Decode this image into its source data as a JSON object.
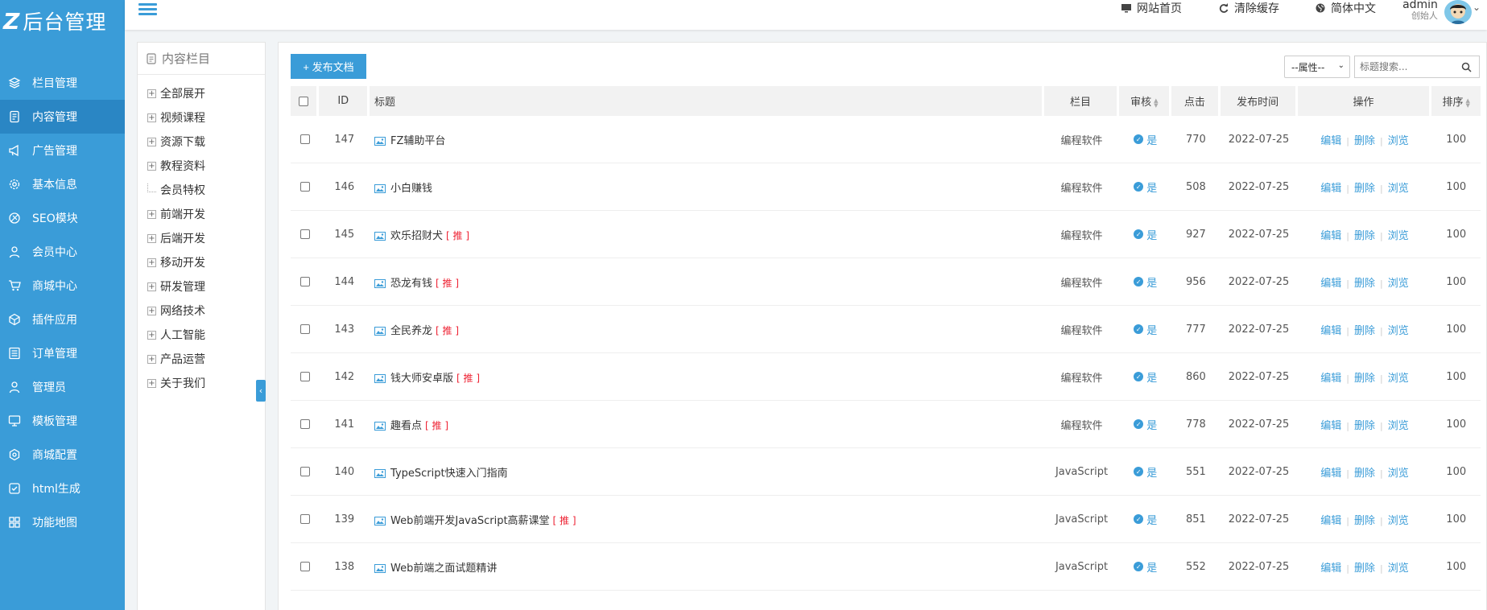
{
  "brand": {
    "logo_mark": "Z",
    "title": "后台管理"
  },
  "sidebar": {
    "items": [
      {
        "label": "栏目管理",
        "icon": "layers-icon",
        "active": false
      },
      {
        "label": "内容管理",
        "icon": "document-icon",
        "active": true
      },
      {
        "label": "广告管理",
        "icon": "megaphone-icon",
        "active": false
      },
      {
        "label": "基本信息",
        "icon": "gear-icon",
        "active": false
      },
      {
        "label": "SEO模块",
        "icon": "seo-icon",
        "active": false
      },
      {
        "label": "会员中心",
        "icon": "user-icon",
        "active": false
      },
      {
        "label": "商城中心",
        "icon": "cart-icon",
        "active": false
      },
      {
        "label": "插件应用",
        "icon": "cube-icon",
        "active": false
      },
      {
        "label": "订单管理",
        "icon": "list-icon",
        "active": false
      },
      {
        "label": "管理员",
        "icon": "admin-user-icon",
        "active": false
      },
      {
        "label": "模板管理",
        "icon": "monitor-icon",
        "active": false
      },
      {
        "label": "商城配置",
        "icon": "settings-hex-icon",
        "active": false
      },
      {
        "label": "html生成",
        "icon": "checkbox-icon",
        "active": false
      },
      {
        "label": "功能地图",
        "icon": "grid-icon",
        "active": false
      }
    ]
  },
  "header": {
    "site_home": "网站首页",
    "clear_cache": "清除缓存",
    "language": "简体中文",
    "username": "admin",
    "role": "创始人"
  },
  "categories": {
    "title": "内容栏目",
    "items": [
      {
        "label": "全部展开",
        "expandable": true
      },
      {
        "label": "视频课程",
        "expandable": true
      },
      {
        "label": "资源下载",
        "expandable": true
      },
      {
        "label": "教程资料",
        "expandable": true
      },
      {
        "label": "会员特权",
        "expandable": false
      },
      {
        "label": "前端开发",
        "expandable": true
      },
      {
        "label": "后端开发",
        "expandable": true
      },
      {
        "label": "移动开发",
        "expandable": true
      },
      {
        "label": "研发管理",
        "expandable": true
      },
      {
        "label": "网络技术",
        "expandable": true
      },
      {
        "label": "人工智能",
        "expandable": true
      },
      {
        "label": "产品运营",
        "expandable": true
      },
      {
        "label": "关于我们",
        "expandable": true
      }
    ]
  },
  "toolbar": {
    "publish_label": "+ 发布文档",
    "attr_select": "--属性--",
    "search_placeholder": "标题搜索..."
  },
  "table": {
    "columns": {
      "id": "ID",
      "title": "标题",
      "column": "栏目",
      "review": "审核",
      "clicks": "点击",
      "date": "发布时间",
      "ops": "操作",
      "sort": "排序"
    },
    "actions": {
      "edit": "编辑",
      "delete": "删除",
      "view": "浏览"
    },
    "rows": [
      {
        "id": "147",
        "title": "FZ辅助平台",
        "tag": "",
        "column": "编程软件",
        "review": "是",
        "clicks": "770",
        "date": "2022-07-25",
        "sort": "100"
      },
      {
        "id": "146",
        "title": "小白赚钱",
        "tag": "",
        "column": "编程软件",
        "review": "是",
        "clicks": "508",
        "date": "2022-07-25",
        "sort": "100"
      },
      {
        "id": "145",
        "title": "欢乐招财犬",
        "tag": "[ 推 ]",
        "column": "编程软件",
        "review": "是",
        "clicks": "927",
        "date": "2022-07-25",
        "sort": "100"
      },
      {
        "id": "144",
        "title": "恐龙有钱",
        "tag": "[ 推 ]",
        "column": "编程软件",
        "review": "是",
        "clicks": "956",
        "date": "2022-07-25",
        "sort": "100"
      },
      {
        "id": "143",
        "title": "全民养龙",
        "tag": "[ 推 ]",
        "column": "编程软件",
        "review": "是",
        "clicks": "777",
        "date": "2022-07-25",
        "sort": "100"
      },
      {
        "id": "142",
        "title": "钱大师安卓版",
        "tag": "[ 推 ]",
        "column": "编程软件",
        "review": "是",
        "clicks": "860",
        "date": "2022-07-25",
        "sort": "100"
      },
      {
        "id": "141",
        "title": "趣看点",
        "tag": "[ 推 ]",
        "column": "编程软件",
        "review": "是",
        "clicks": "778",
        "date": "2022-07-25",
        "sort": "100"
      },
      {
        "id": "140",
        "title": "TypeScript快速入门指南",
        "tag": "",
        "column": "JavaScript",
        "review": "是",
        "clicks": "551",
        "date": "2022-07-25",
        "sort": "100"
      },
      {
        "id": "139",
        "title": "Web前端开发JavaScript高薪课堂",
        "tag": "[ 推 ]",
        "column": "JavaScript",
        "review": "是",
        "clicks": "851",
        "date": "2022-07-25",
        "sort": "100"
      },
      {
        "id": "138",
        "title": "Web前端之面试题精讲",
        "tag": "",
        "column": "JavaScript",
        "review": "是",
        "clicks": "552",
        "date": "2022-07-25",
        "sort": "100"
      }
    ]
  }
}
